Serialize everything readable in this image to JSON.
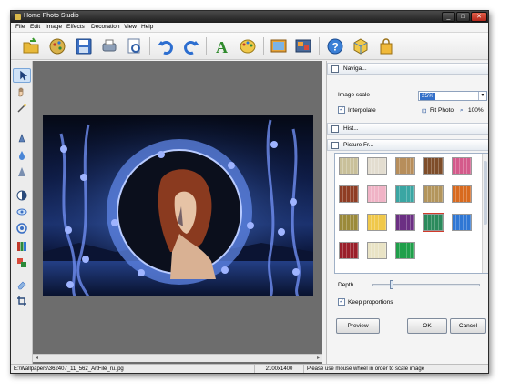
{
  "window": {
    "title": "Home Photo Studio"
  },
  "menu": [
    "File",
    "Edit",
    "Image",
    "Effects",
    "Decoration",
    "View",
    "Help"
  ],
  "toolbar_icons": [
    "open-folder-icon",
    "palette-wheel-icon",
    "save-icon",
    "print-icon",
    "preview-icon",
    "undo-icon",
    "redo-icon",
    "text-icon",
    "color-palette-icon",
    "image-frame-icon",
    "collage-icon",
    "help-icon",
    "3d-cube-icon",
    "bag-icon"
  ],
  "left_tools": [
    "pointer-icon",
    "hand-icon",
    "magic-wand-icon",
    "dropper-icon",
    "drop-icon",
    "cone-icon",
    "contrast-icon",
    "eye-icon",
    "target-icon",
    "levels-icon",
    "color-icon",
    "eraser-icon",
    "crop-icon"
  ],
  "navigator": {
    "header": "Naviga...",
    "image_scale_label": "Image scale",
    "image_scale_value": "25%",
    "interpolate_label": "Interpolate",
    "interpolate_checked": true,
    "fit_photo_label": "Fit Photo",
    "zoom_100_label": "100%"
  },
  "histogram": {
    "header": "Hist..."
  },
  "picture_frames": {
    "header": "Picture Fr...",
    "swatch_colors": [
      [
        "#c9c09a",
        "#e3ddd0",
        "#b78e5b",
        "#7e4d2a",
        "#d45a8b"
      ],
      [
        "#8f3d24",
        "#f0b3c6",
        "#3aa6a3",
        "#b3955c",
        "#d86a1f"
      ],
      [
        "#9b8a3a",
        "#f0c84a",
        "#6b2f83",
        "#2b8a5c",
        "#2f77d4"
      ],
      [
        "#9a1f2a",
        "#e9e3c5",
        "#1f9f4a"
      ]
    ],
    "selected": [
      2,
      3
    ],
    "depth_label": "Depth",
    "depth_value": 0.17,
    "keep_proportions_label": "Keep proportions",
    "keep_proportions_checked": true
  },
  "buttons": {
    "preview": "Preview",
    "ok": "OK",
    "cancel": "Cancel"
  },
  "status": {
    "path": "E:\\Wallpapers\\362407_11_562_ArtFile_ru.jpg",
    "dimensions": "2100x1400",
    "hint": "Please use mouse wheel in order to scale image"
  },
  "colors": {
    "accent": "#3470c9",
    "close_button": "#c0392b"
  }
}
